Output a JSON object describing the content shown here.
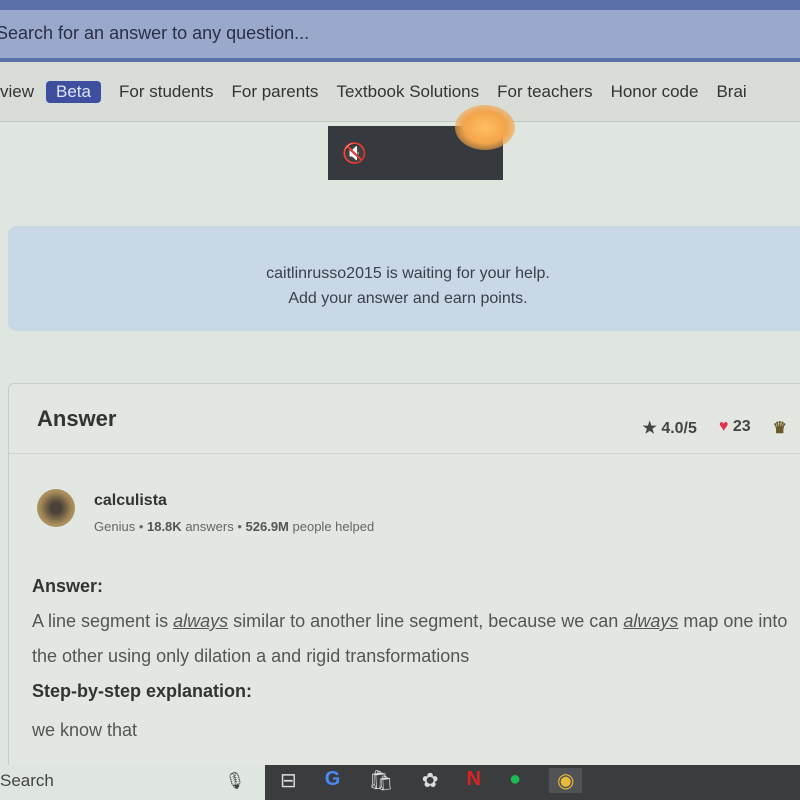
{
  "header": {
    "search_placeholder": "Search for an answer to any question..."
  },
  "nav": {
    "items": [
      "view",
      "For students",
      "For parents",
      "Textbook Solutions",
      "For teachers",
      "Honor code",
      "Brai"
    ],
    "beta": "Beta"
  },
  "video": {
    "icon": "muted-speaker-icon",
    "glyph": "🔇"
  },
  "notice": {
    "line1": "caitlinrusso2015 is waiting for your help.",
    "line2": "Add your answer and earn points."
  },
  "answer": {
    "title": "Answer",
    "rating": "4.0/5",
    "likes": "23",
    "user": {
      "name": "calculista",
      "rank": "Genius",
      "answers": "18.8K",
      "answers_label": "answers",
      "helped": "526.9M",
      "helped_label": "people helped"
    },
    "label": "Answer:",
    "text_parts": [
      "A line segment is ",
      "always",
      " similar to another line segment, because we can ",
      "always",
      " map one into the other using only dilation a and rigid transformations"
    ],
    "step_label": "Step-by-step explanation:",
    "step_text": "we know that"
  },
  "taskbar": {
    "search": "Search",
    "apps": [
      "task-view",
      "google",
      "microsoft-store",
      "photos",
      "netflix",
      "spotify",
      "chrome"
    ]
  },
  "colors": {
    "nav_beta": "#3f4fa0",
    "heart": "#e0344a",
    "notice_bg": "#c9d8e6"
  }
}
